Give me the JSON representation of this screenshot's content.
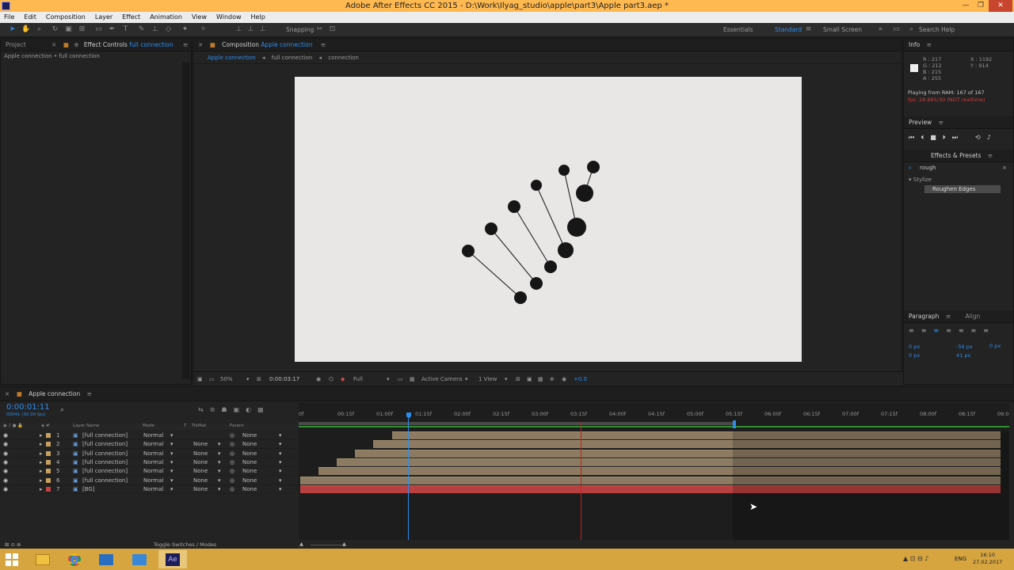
{
  "window": {
    "title": "Adobe After Effects CC 2015 - D:\\Work\\Ilyag_studio\\apple\\part3\\Apple part3.aep *"
  },
  "menu": [
    "File",
    "Edit",
    "Composition",
    "Layer",
    "Effect",
    "Animation",
    "View",
    "Window",
    "Help"
  ],
  "toolbar": {
    "snapping": "Snapping",
    "workspaces": [
      "Essentials",
      "Standard",
      "Small Screen"
    ],
    "search_help": "Search Help"
  },
  "left_panel": {
    "tab_project": "Project",
    "tab_effect_controls": "Effect Controls",
    "effect_target": "full connection",
    "breadcrumb": "Apple connection • full connection"
  },
  "comp_panel": {
    "tab_label": "Composition",
    "comp_name": "Apple connection",
    "flow": [
      "Apple connection",
      "full connection",
      "connection"
    ],
    "zoom": "50%",
    "time": "0:00:03:17",
    "resolution": "Full",
    "camera": "Active Camera",
    "views": "1 View",
    "exposure": "+0.0"
  },
  "info": {
    "title": "Info",
    "r": "R : 217",
    "g": "G : 212",
    "b": "B : 215",
    "a": "A : 255",
    "x": "X : 1192",
    "y": "Y : 914",
    "ram": "Playing from RAM: 167 of 167",
    "fps": "fps: 28.885/30 (NOT realtime)"
  },
  "preview": {
    "title": "Preview"
  },
  "effects": {
    "title": "Effects & Presets",
    "search": "rough",
    "category": "Stylize",
    "item": "Roughen Edges"
  },
  "paragraph": {
    "title": "Paragraph",
    "align_tab": "Align",
    "indent1": "0 px",
    "indent2": "0 px",
    "indent3": "0 px",
    "space1": "-56 px",
    "space2": "41 px"
  },
  "timeline": {
    "tab": "Apple connection",
    "timecode": "0:00:01:11",
    "fps": "00041 (30.00 fps)",
    "col_layer": "Layer Name",
    "col_mode": "Mode",
    "col_t": "T",
    "col_trkmat": "TrkMat",
    "col_parent": "Parent",
    "toggle": "Toggle Switches / Modes",
    "ruler": [
      "0f",
      "00:15f",
      "01:00f",
      "01:15f",
      "02:00f",
      "02:15f",
      "03:00f",
      "03:15f",
      "04:00f",
      "04:15f",
      "05:00f",
      "05:15f",
      "06:00f",
      "06:15f",
      "07:00f",
      "07:15f",
      "08:00f",
      "08:15f",
      "09:0"
    ],
    "layers": [
      {
        "num": "1",
        "name": "[full connection]",
        "mode": "Normal",
        "trkmat": "",
        "parent": "None"
      },
      {
        "num": "2",
        "name": "[full connection]",
        "mode": "Normal",
        "trkmat": "None",
        "parent": "None"
      },
      {
        "num": "3",
        "name": "[full connection]",
        "mode": "Normal",
        "trkmat": "None",
        "parent": "None"
      },
      {
        "num": "4",
        "name": "[full connection]",
        "mode": "Normal",
        "trkmat": "None",
        "parent": "None"
      },
      {
        "num": "5",
        "name": "[full connection]",
        "mode": "Normal",
        "trkmat": "None",
        "parent": "None"
      },
      {
        "num": "6",
        "name": "[full connection]",
        "mode": "Normal",
        "trkmat": "None",
        "parent": "None"
      },
      {
        "num": "7",
        "name": "[BG]",
        "mode": "Normal",
        "trkmat": "None",
        "parent": "None"
      }
    ]
  },
  "taskbar": {
    "lang": "ENG",
    "time": "16:10",
    "date": "27.02.2017"
  },
  "colors": {
    "accent": "#2d8ceb",
    "titlebar": "#ffb950",
    "taskbar": "#d6a540"
  }
}
